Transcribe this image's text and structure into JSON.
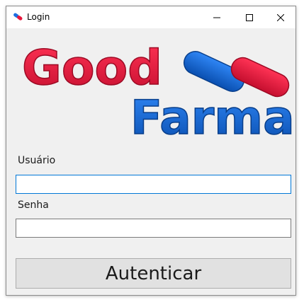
{
  "window": {
    "title": "Login",
    "icon": "pill-icon"
  },
  "window_controls": {
    "minimize_icon": "minimize-icon",
    "maximize_icon": "maximize-icon",
    "close_icon": "close-icon"
  },
  "logo": {
    "word1": "Good",
    "word2": "Farma",
    "colors": {
      "red": "#e8163c",
      "blue": "#1e6fe0",
      "blue_dark": "#0a4fb0"
    }
  },
  "form": {
    "username_label": "Usuário",
    "username_value": "",
    "password_label": "Senha",
    "password_value": "",
    "submit_label": "Autenticar"
  }
}
